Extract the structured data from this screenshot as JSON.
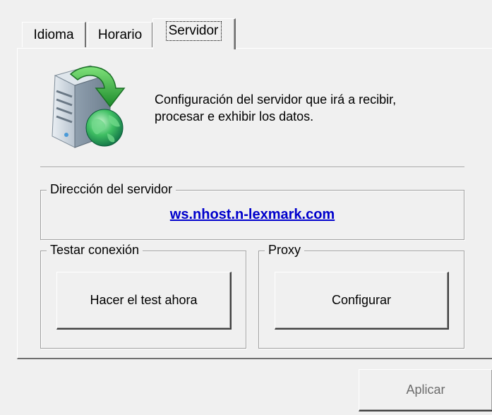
{
  "tabs": [
    {
      "label": "Idioma",
      "active": false
    },
    {
      "label": "Horario",
      "active": false
    },
    {
      "label": "Servidor",
      "active": true
    }
  ],
  "panel": {
    "description_line1": "Configuración del servidor que irá a recibir,",
    "description_line2": "procesar e exhibir los datos.",
    "server_group": {
      "title": "Dirección del servidor",
      "address": "ws.nhost.n-lexmark.com"
    },
    "test_group": {
      "title": "Testar conexión",
      "button_label": "Hacer el test ahora"
    },
    "proxy_group": {
      "title": "Proxy",
      "button_label": "Configurar"
    }
  },
  "footer": {
    "apply_label": "Aplicar",
    "apply_enabled": false
  },
  "icons": {
    "server": "server-with-download-arrow-and-globe-icon"
  },
  "colors": {
    "link": "#0000cc",
    "background": "#f0f0f0",
    "disabled_text": "#6d6d6d"
  }
}
